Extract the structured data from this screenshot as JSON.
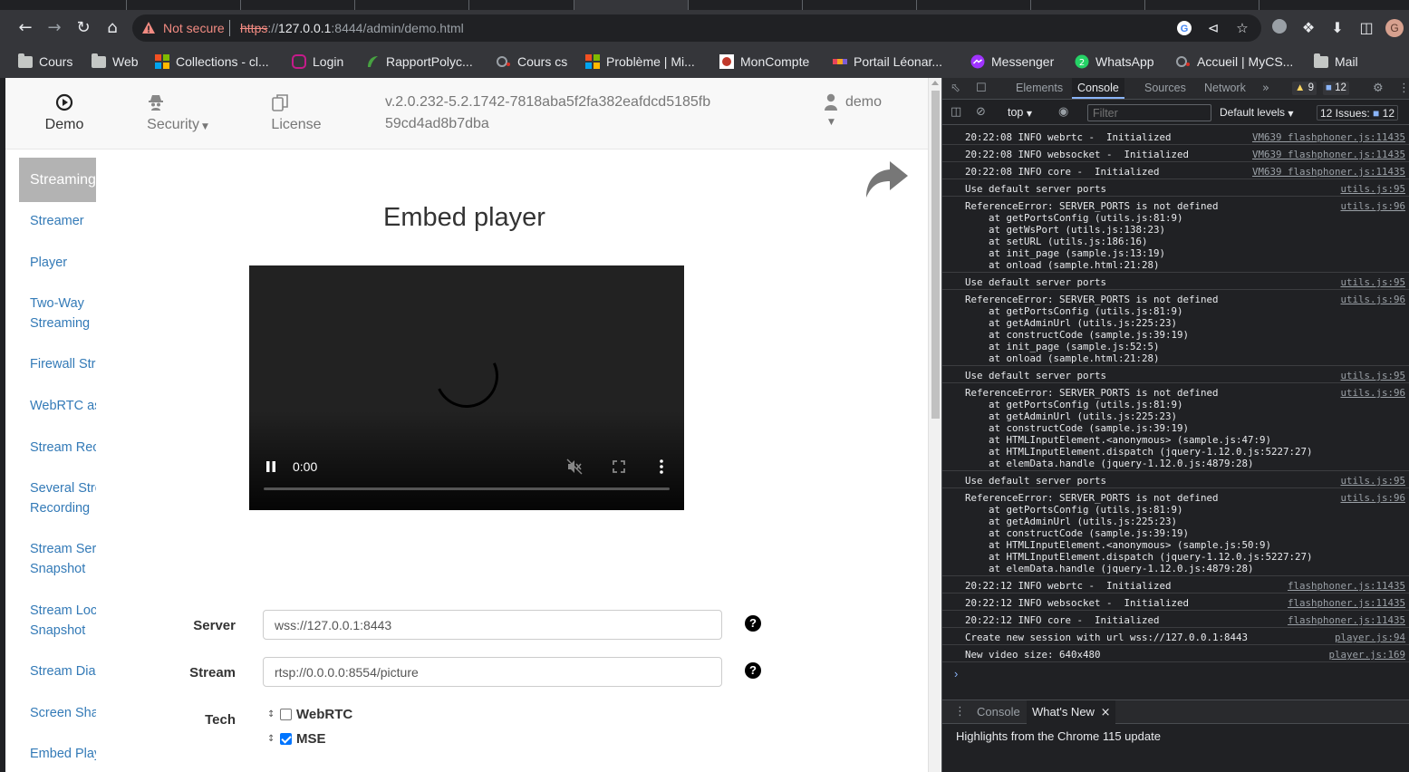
{
  "browser": {
    "not_secure": "Not secure",
    "url_scheme": "https",
    "url_sep": "://",
    "url_host": "127.0.0.1",
    "url_rest": ":8444/admin/demo.html",
    "profile_initial": "G"
  },
  "bookmarks": [
    {
      "label": "Cours",
      "icon": "folder-icon"
    },
    {
      "label": "Web",
      "icon": "folder-icon"
    },
    {
      "label": "Collections - cl...",
      "icon": "microsoft-icon"
    },
    {
      "label": "Login",
      "icon": "login-icon"
    },
    {
      "label": "RapportPolyc...",
      "icon": "overleaf-icon"
    },
    {
      "label": "Cours cs",
      "icon": "cs-icon"
    },
    {
      "label": "Problème | Mi...",
      "icon": "microsoft-icon"
    },
    {
      "label": "MonCompte",
      "icon": "moncompte-icon"
    },
    {
      "label": "Portail Léonar...",
      "icon": "leonard-icon"
    },
    {
      "label": "Messenger",
      "icon": "messenger-icon"
    },
    {
      "label": "WhatsApp",
      "icon": "whatsapp-icon"
    },
    {
      "label": "Accueil | MyCS...",
      "icon": "mycs-icon"
    },
    {
      "label": "Mail",
      "icon": "folder-icon"
    }
  ],
  "navbar": {
    "demo": "Demo",
    "security": "Security",
    "license": "License",
    "version": "v.2.0.232-5.2.1742-7818aba5f2fa382eafdcd5185fb59cd4ad8b7dba",
    "user": "demo"
  },
  "sidebar": [
    {
      "label": "Streaming",
      "active": true
    },
    {
      "label": "Streamer"
    },
    {
      "label": "Player"
    },
    {
      "label": "Two-Way",
      "label2": "Streaming"
    },
    {
      "label": "Firewall Str"
    },
    {
      "label": "WebRTC as"
    },
    {
      "label": "Stream Rec"
    },
    {
      "label": "Several Stre",
      "label2": "Recording"
    },
    {
      "label": "Stream Ser",
      "label2": "Snapshot"
    },
    {
      "label": "Stream Loc",
      "label2": "Snapshot"
    },
    {
      "label": "Stream Dia"
    },
    {
      "label": "Screen Sha"
    },
    {
      "label": "Embed Play"
    }
  ],
  "main": {
    "title": "Embed player",
    "video_time": "0:00",
    "form": {
      "server_label": "Server",
      "server_value": "wss://127.0.0.1:8443",
      "stream_label": "Stream",
      "stream_value": "rtsp://0.0.0.0:8554/picture",
      "tech_label": "Tech",
      "tech_options": [
        {
          "label": "WebRTC",
          "checked": false
        },
        {
          "label": "MSE",
          "checked": true
        }
      ]
    }
  },
  "devtools": {
    "tabs": [
      "Elements",
      "Console",
      "Sources",
      "Network"
    ],
    "active_tab": "Console",
    "warnings": "9",
    "messages": "12",
    "context": "top",
    "filter_placeholder": "Filter",
    "levels": "Default levels",
    "issues_label": "12 Issues:",
    "issues_count": "12",
    "logs": [
      {
        "lines": [
          "20:22:08 INFO webrtc -  Initialized"
        ],
        "src": "VM639 flashphoner.js:11435"
      },
      {
        "lines": [
          "20:22:08 INFO websocket -  Initialized"
        ],
        "src": "VM639 flashphoner.js:11435"
      },
      {
        "lines": [
          "20:22:08 INFO core -  Initialized"
        ],
        "src": "VM639 flashphoner.js:11435"
      },
      {
        "lines": [
          "Use default server ports"
        ],
        "src": "utils.js:95"
      },
      {
        "lines": [
          "ReferenceError: SERVER_PORTS is not defined",
          "    at getPortsConfig (utils.js:81:9)",
          "    at getWsPort (utils.js:138:23)",
          "    at setURL (utils.js:186:16)",
          "    at init_page (sample.js:13:19)",
          "    at onload (sample.html:21:28)"
        ],
        "src": "utils.js:96"
      },
      {
        "lines": [
          "Use default server ports"
        ],
        "src": "utils.js:95"
      },
      {
        "lines": [
          "ReferenceError: SERVER_PORTS is not defined",
          "    at getPortsConfig (utils.js:81:9)",
          "    at getAdminUrl (utils.js:225:23)",
          "    at constructCode (sample.js:39:19)",
          "    at init_page (sample.js:52:5)",
          "    at onload (sample.html:21:28)"
        ],
        "src": "utils.js:96"
      },
      {
        "lines": [
          "Use default server ports"
        ],
        "src": "utils.js:95"
      },
      {
        "lines": [
          "ReferenceError: SERVER_PORTS is not defined",
          "    at getPortsConfig (utils.js:81:9)",
          "    at getAdminUrl (utils.js:225:23)",
          "    at constructCode (sample.js:39:19)",
          "    at HTMLInputElement.<anonymous> (sample.js:47:9)",
          "    at HTMLInputElement.dispatch (jquery-1.12.0.js:5227:27)",
          "    at elemData.handle (jquery-1.12.0.js:4879:28)"
        ],
        "src": "utils.js:96"
      },
      {
        "lines": [
          "Use default server ports"
        ],
        "src": "utils.js:95"
      },
      {
        "lines": [
          "ReferenceError: SERVER_PORTS is not defined",
          "    at getPortsConfig (utils.js:81:9)",
          "    at getAdminUrl (utils.js:225:23)",
          "    at constructCode (sample.js:39:19)",
          "    at HTMLInputElement.<anonymous> (sample.js:50:9)",
          "    at HTMLInputElement.dispatch (jquery-1.12.0.js:5227:27)",
          "    at elemData.handle (jquery-1.12.0.js:4879:28)"
        ],
        "src": "utils.js:96"
      },
      {
        "lines": [
          "20:22:12 INFO webrtc -  Initialized"
        ],
        "src": "flashphoner.js:11435"
      },
      {
        "lines": [
          "20:22:12 INFO websocket -  Initialized"
        ],
        "src": "flashphoner.js:11435"
      },
      {
        "lines": [
          "20:22:12 INFO core -  Initialized"
        ],
        "src": "flashphoner.js:11435"
      },
      {
        "lines": [
          "Create new session with url wss://127.0.0.1:8443"
        ],
        "src": "player.js:94"
      },
      {
        "lines": [
          "New video size: 640x480"
        ],
        "src": "player.js:169"
      }
    ],
    "drawer_tabs": [
      "Console",
      "What's New"
    ],
    "drawer_active": "What's New",
    "whats_new": "Highlights from the Chrome 115 update"
  }
}
